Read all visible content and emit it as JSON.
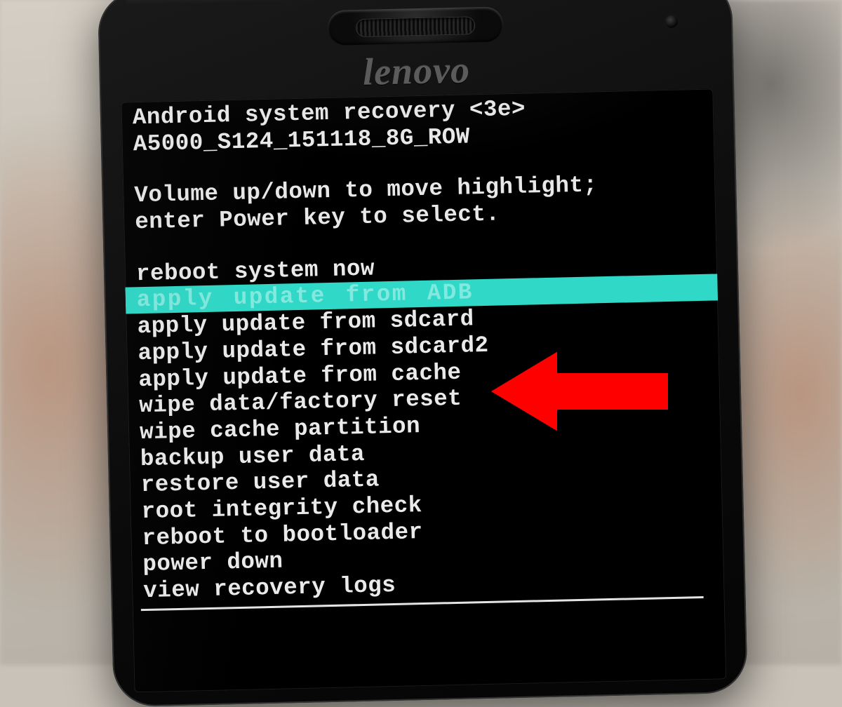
{
  "device": {
    "brand": "lenovo"
  },
  "recovery": {
    "title": "Android system recovery <3e>",
    "build": "A5000_S124_151118_8G_ROW",
    "instructions_line1": "Volume up/down to move highlight;",
    "instructions_line2": "enter Power key to select.",
    "menu": [
      {
        "label": "reboot system now",
        "highlighted": false
      },
      {
        "label": "apply update from ADB",
        "highlighted": true
      },
      {
        "label": "apply update from sdcard",
        "highlighted": false
      },
      {
        "label": "apply update from sdcard2",
        "highlighted": false
      },
      {
        "label": "apply update from cache",
        "highlighted": false
      },
      {
        "label": "wipe data/factory reset",
        "highlighted": false
      },
      {
        "label": "wipe cache partition",
        "highlighted": false
      },
      {
        "label": "backup user data",
        "highlighted": false
      },
      {
        "label": "restore user data",
        "highlighted": false
      },
      {
        "label": "root integrity check",
        "highlighted": false
      },
      {
        "label": "reboot to bootloader",
        "highlighted": false
      },
      {
        "label": "power down",
        "highlighted": false
      },
      {
        "label": "view recovery logs",
        "highlighted": false
      }
    ]
  },
  "annotation": {
    "arrow_points_to": "wipe data/factory reset",
    "arrow_color": "#ff0000"
  }
}
